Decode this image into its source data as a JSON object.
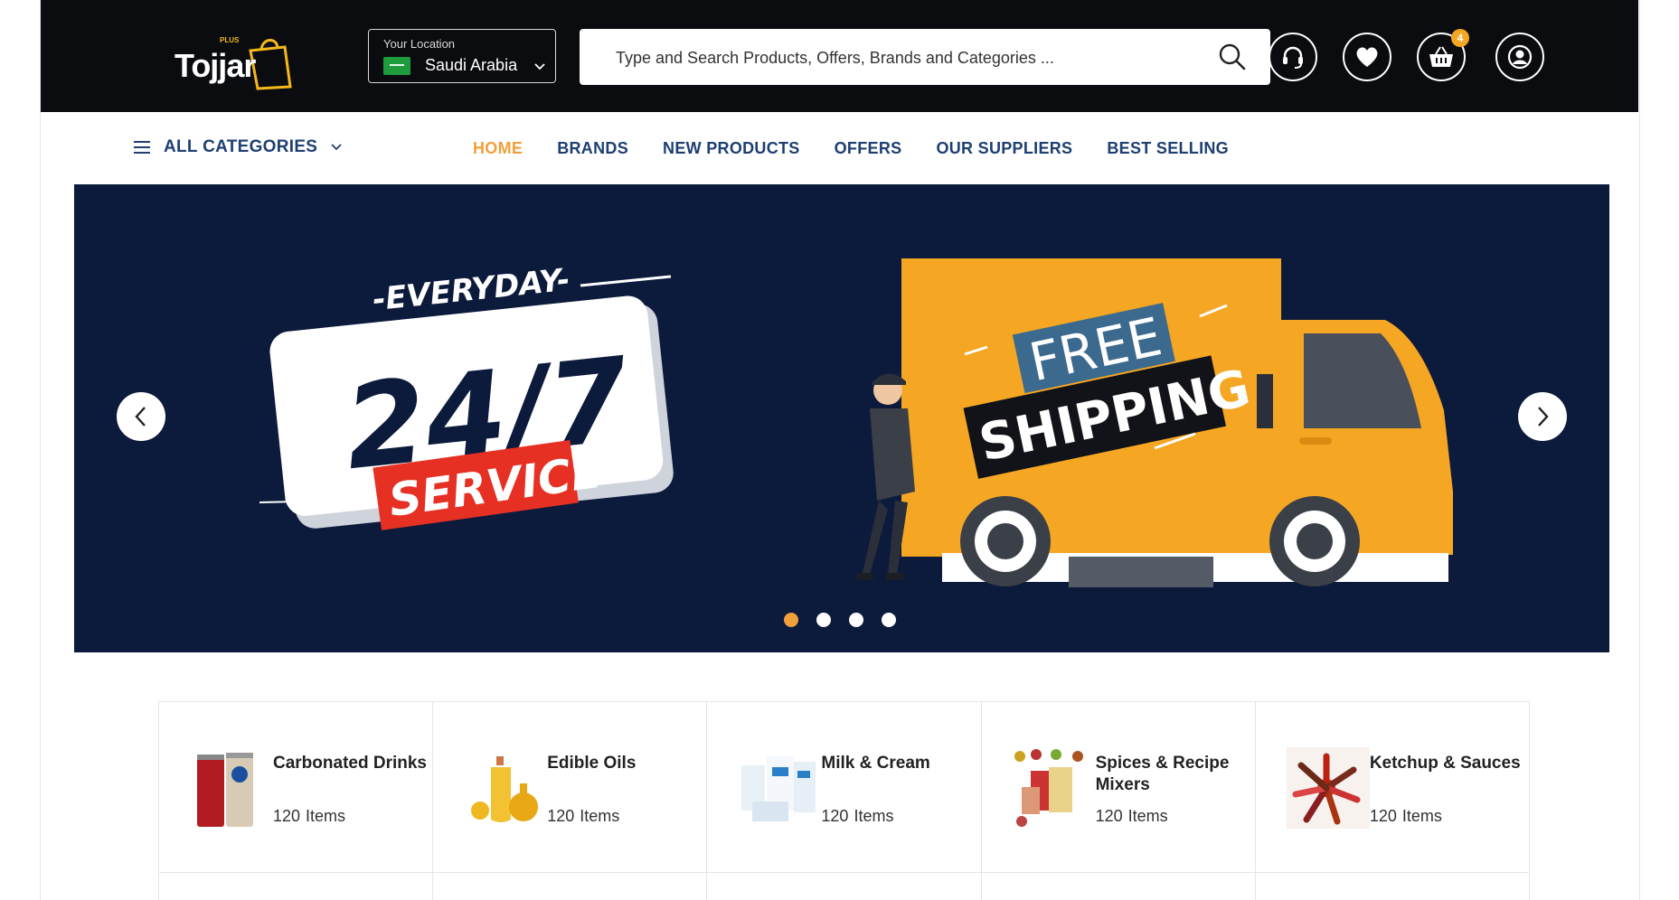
{
  "brand": {
    "name": "Tojjar",
    "plus_label": "PLUS"
  },
  "location": {
    "label": "Your Location",
    "country": "Saudi Arabia"
  },
  "search": {
    "placeholder": "Type and Search Products, Offers, Brands and Categories ..."
  },
  "header_icons": {
    "support": "headset-icon",
    "wishlist": "heart-icon",
    "cart": "basket-icon",
    "cart_count": "4",
    "account": "user-icon"
  },
  "nav": {
    "all_categories": "ALL CATEGORIES",
    "items": [
      {
        "label": "HOME",
        "active": true
      },
      {
        "label": "BRANDS",
        "active": false
      },
      {
        "label": "NEW PRODUCTS",
        "active": false
      },
      {
        "label": "OFFERS",
        "active": false
      },
      {
        "label": "OUR SUPPLIERS",
        "active": false
      },
      {
        "label": "BEST SELLING",
        "active": false
      }
    ]
  },
  "banner": {
    "everyday": "-EVERYDAY-",
    "hours": "24/7",
    "service": "SERVICE",
    "free": "FREE",
    "shipping": "SHIPPING",
    "slides": 4,
    "active_slide": 1
  },
  "categories": [
    {
      "name": "Carbonated Drinks",
      "count": "120",
      "unit": "Items"
    },
    {
      "name": "Edible Oils",
      "count": "120",
      "unit": "Items"
    },
    {
      "name": "Milk & Cream",
      "count": "120",
      "unit": "Items"
    },
    {
      "name": "Spices & Recipe Mixers",
      "count": "120",
      "unit": "Items"
    },
    {
      "name": "Ketchup & Sauces",
      "count": "120",
      "unit": "Items"
    }
  ],
  "colors": {
    "header_bg": "#0b0c10",
    "accent": "#f0a03a",
    "nav_text": "#1d3f72",
    "banner_bg": "#0c1a3b"
  }
}
